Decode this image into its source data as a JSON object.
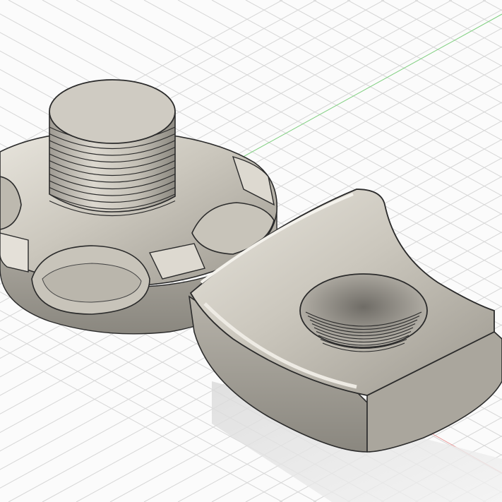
{
  "viewport": {
    "background": "#fbfbfb",
    "grid_color": "#d6d6d6",
    "x_axis_color": "#e06666",
    "y_axis_color": "#66bb66",
    "model_color": "#cfcbc1",
    "model_shadow_color": "#8d8a83",
    "edge_color": "#2b2b2b"
  },
  "scene": {
    "parts": [
      "threaded-knob",
      "saddle-clamp"
    ]
  }
}
